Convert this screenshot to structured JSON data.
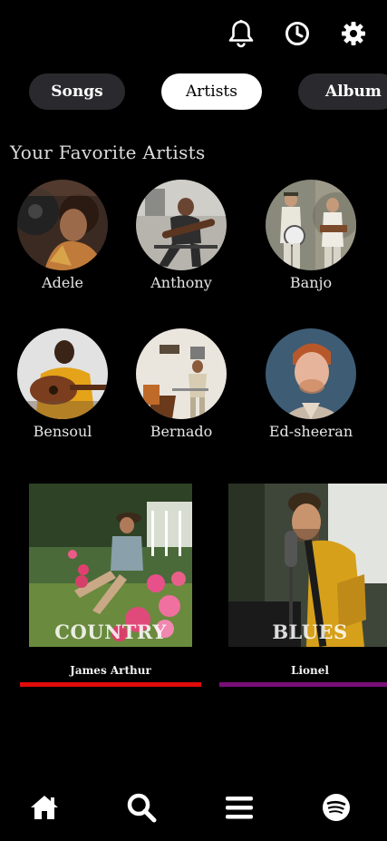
{
  "header": {
    "icons": [
      "bell-icon",
      "history-icon",
      "gear-icon"
    ]
  },
  "tabs": [
    {
      "label": "Songs",
      "active": false
    },
    {
      "label": "Artists",
      "active": true
    },
    {
      "label": "Album",
      "active": false
    }
  ],
  "section": {
    "title": "Your Favorite Artists"
  },
  "artists": [
    {
      "name": "Adele"
    },
    {
      "name": "Anthony"
    },
    {
      "name": "Banjo"
    },
    {
      "name": "Bensoul"
    },
    {
      "name": "Bernado"
    },
    {
      "name": "Ed-sheeran"
    }
  ],
  "genres": [
    {
      "genre": "COUNTRY",
      "artist": "James Arthur",
      "accent": "#e00b0b"
    },
    {
      "genre": "BLUES",
      "artist": "Lionel",
      "accent": "#7a0f7a"
    }
  ],
  "colors": {
    "background": "#000000",
    "tab_inactive": "#2a2a2e",
    "tab_active": "#ffffff"
  },
  "nav": {
    "items": [
      "home-icon",
      "search-icon",
      "menu-icon",
      "spotify-icon"
    ]
  }
}
